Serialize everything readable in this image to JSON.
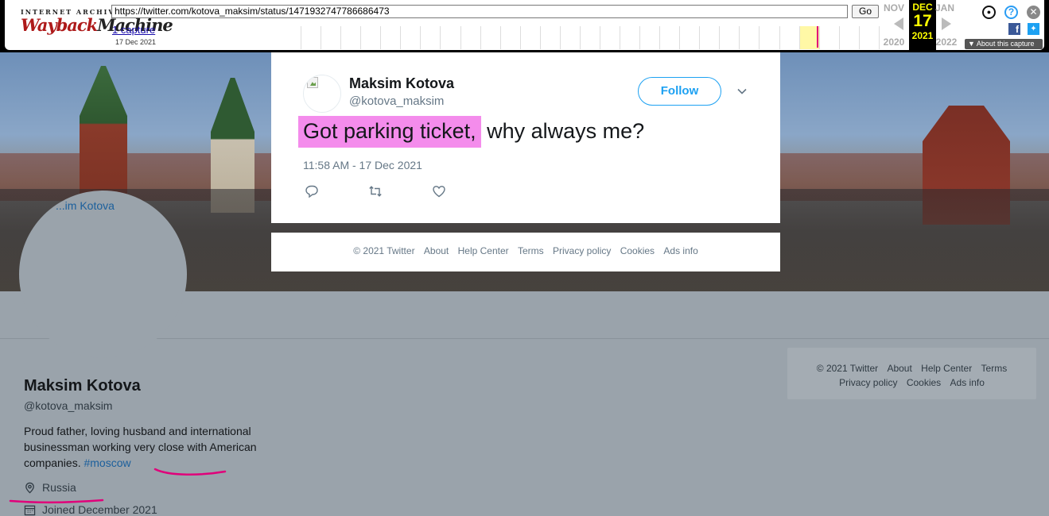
{
  "wayback": {
    "logo_top": "INTERNET ARCHIVE",
    "logo_way": "Wayback",
    "logo_machine": "Machine",
    "url": "https://twitter.com/kotova_maksim/status/1471932747786686473",
    "go_label": "Go",
    "captures": "1 capture",
    "capture_date": "17 Dec 2021",
    "prev_month": "NOV",
    "prev_year": "2020",
    "cur_month": "DEC",
    "cur_day": "17",
    "cur_year": "2021",
    "next_month": "JAN",
    "next_year": "2022",
    "about_capture": "About this capture"
  },
  "tweet": {
    "name": "Maksim Kotova",
    "handle": "@kotova_maksim",
    "follow_label": "Follow",
    "text_highlighted": "Got parking ticket,",
    "text_rest": " why always me?",
    "timestamp": "11:58 AM - 17 Dec 2021",
    "highlight_color": "#f48cec"
  },
  "tweet_footer": {
    "copyright": "© 2021 Twitter",
    "about": "About",
    "help": "Help Center",
    "terms": "Terms",
    "privacy": "Privacy policy",
    "cookies": "Cookies",
    "ads": "Ads info"
  },
  "profile": {
    "avatar_alt": "...im Kotova",
    "name": "Maksim Kotova",
    "handle": "@kotova_maksim",
    "bio": "Proud father, loving husband and international businessman working very close with American companies.",
    "hashtag": "#moscow",
    "location": "Russia",
    "joined": "Joined December 2021",
    "underline_color": "#e0007a"
  },
  "side_footer": {
    "copyright": "© 2021 Twitter",
    "about": "About",
    "help": "Help Center",
    "terms": "Terms",
    "privacy": "Privacy policy",
    "cookies": "Cookies",
    "ads": "Ads info"
  },
  "colors": {
    "twitter_blue": "#1da1f2",
    "wayback_black": "#000000",
    "wayback_current": "#ffff00"
  }
}
